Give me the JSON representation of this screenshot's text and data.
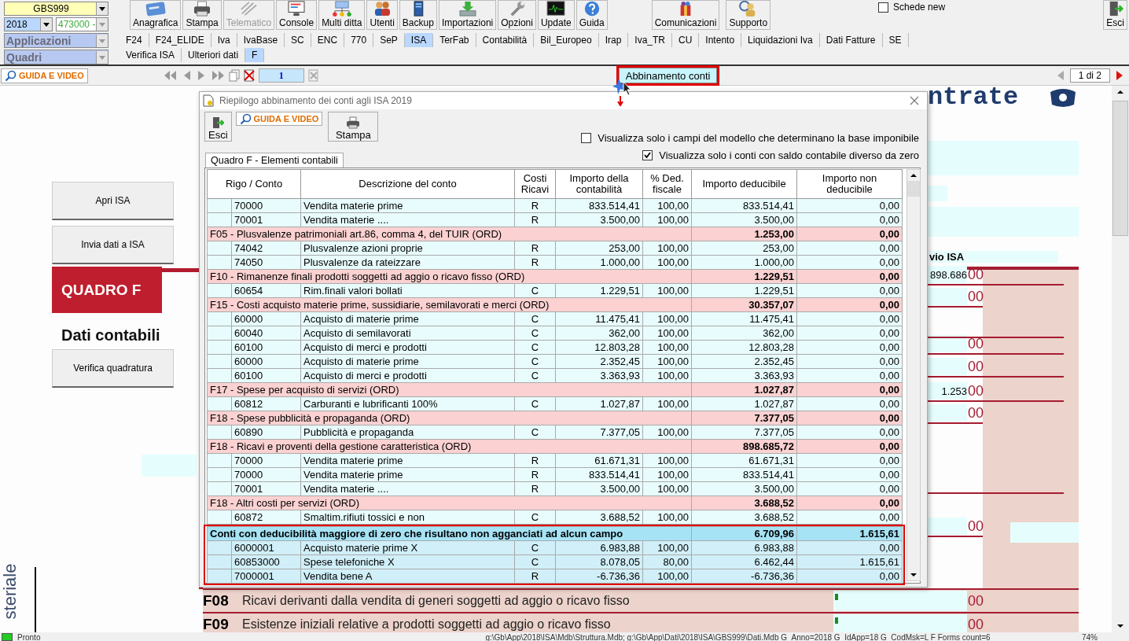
{
  "company_combo": {
    "value": "GBS999"
  },
  "year_combo": {
    "value": "2018"
  },
  "account_combo": {
    "value": "473000 -",
    "disabled": true
  },
  "applications_combo": {
    "value": "Applicazioni"
  },
  "panels_combo": {
    "value": "Quadri"
  },
  "toolbar": [
    {
      "label": "Anagrafica",
      "disabled": false
    },
    {
      "label": "Stampa",
      "disabled": false
    },
    {
      "label": "Telematico",
      "disabled": true
    },
    {
      "label": "Console",
      "disabled": false
    },
    {
      "label": "Multi ditta",
      "disabled": false
    },
    {
      "label": "Utenti",
      "disabled": false
    },
    {
      "label": "Backup",
      "disabled": false
    },
    {
      "label": "Importazioni",
      "disabled": false
    },
    {
      "label": "Opzioni",
      "disabled": false
    },
    {
      "label": "Update",
      "disabled": false
    },
    {
      "label": "Guida",
      "disabled": false
    }
  ],
  "toolbar_right": [
    {
      "label": "Comunicazioni"
    },
    {
      "label": "Supporto"
    }
  ],
  "schede_new": {
    "label": "Schede new",
    "checked": false
  },
  "exit_button": {
    "label": "Esci"
  },
  "app_tabs": [
    {
      "label": "F24",
      "selected": false
    },
    {
      "label": "F24_ELIDE",
      "selected": false
    },
    {
      "label": "Iva",
      "selected": false
    },
    {
      "label": "IvaBase",
      "selected": false
    },
    {
      "label": "SC",
      "selected": false
    },
    {
      "label": "ENC",
      "selected": false
    },
    {
      "label": "770",
      "selected": false
    },
    {
      "label": "SeP",
      "selected": false
    },
    {
      "label": "ISA",
      "selected": true
    },
    {
      "label": "TerFab",
      "selected": false
    },
    {
      "label": "Contabilità",
      "selected": false
    },
    {
      "label": "Bil_Europeo",
      "selected": false
    },
    {
      "label": "Irap",
      "selected": false
    },
    {
      "label": "Iva_TR",
      "selected": false
    },
    {
      "label": "CU",
      "selected": false
    },
    {
      "label": "Intento",
      "selected": false
    },
    {
      "label": "Liquidazioni Iva",
      "selected": false
    },
    {
      "label": "Dati Fatture",
      "selected": false
    },
    {
      "label": "SE",
      "selected": false
    }
  ],
  "sub_tabs": [
    {
      "label": "Verifica ISA",
      "selected": false
    },
    {
      "label": "Ulteriori dati",
      "selected": false
    },
    {
      "label": "F",
      "selected": true
    }
  ],
  "nav_bar": {
    "help_button": "GUIDA E VIDEO",
    "page": "1",
    "match_button": {
      "label": "Abbinamento conti",
      "highlighted": true
    },
    "page_counter": "1 di 2"
  },
  "document": {
    "logo_text": "ntrate",
    "buttons": [
      "Apri ISA",
      "Invia dati a ISA"
    ],
    "section_title": "QUADRO F",
    "subtitle": "Dati contabili",
    "verify_button": "Verifica quadratura",
    "column_heading": "vio ISA",
    "side_text": "steriale",
    "fields": [
      {
        "value": "898.686",
        "cents": "00"
      },
      {
        "cents": "00"
      },
      {
        "cents": "00"
      },
      {
        "cents": "00"
      },
      {
        "value": "1.253",
        "cents": "00"
      },
      {
        "cents": "00"
      },
      {
        "cents": "00"
      }
    ],
    "lines": [
      {
        "code": "F08",
        "text": "Ricavi derivanti dalla vendita di generi soggetti ad aggio o ricavo fisso",
        "cents": "00"
      },
      {
        "code": "F09",
        "text": "Esistenze iniziali relative a prodotti soggetti ad aggio o ricavo fisso",
        "cents": "00"
      }
    ]
  },
  "dialog": {
    "title": "Riepilogo abbinamento dei conti agli ISA 2019",
    "exit_button": "Esci",
    "help_button": "GUIDA E VIDEO",
    "print_button": "Stampa",
    "options": [
      {
        "label": "Visualizza solo i campi del modello che determinano la base imponibile",
        "checked": false
      },
      {
        "label": "Visualizza solo i conti con saldo contabile diverso da zero",
        "checked": true
      }
    ],
    "tab": "Quadro F - Elementi contabili",
    "columns": [
      "Rigo / Conto",
      "Descrizione del conto",
      "Costi Ricavi",
      "Importo della contabilità",
      "% Ded. fiscale",
      "Importo deducibile",
      "Importo non deducibile"
    ],
    "rows": [
      {
        "kind": "account",
        "code": "70000",
        "description": "Vendita materie prime",
        "type": "R",
        "amount": "833.514,41",
        "percent": "100,00",
        "deductible": "833.514,41",
        "non_deductible": "0,00"
      },
      {
        "kind": "account",
        "code": "70001",
        "description": "Vendita materie ....",
        "type": "R",
        "amount": "3.500,00",
        "percent": "100,00",
        "deductible": "3.500,00",
        "non_deductible": "0,00"
      },
      {
        "kind": "group",
        "title": "F05 - Plusvalenze patrimoniali art.86, comma 4, del TUIR (ORD)",
        "deductible": "1.253,00",
        "non_deductible": "0,00"
      },
      {
        "kind": "account",
        "code": "74042",
        "description": "Plusvalenze azioni proprie",
        "type": "R",
        "amount": "253,00",
        "percent": "100,00",
        "deductible": "253,00",
        "non_deductible": "0,00"
      },
      {
        "kind": "account",
        "code": "74050",
        "description": "Plusvalenze da rateizzare",
        "type": "R",
        "amount": "1.000,00",
        "percent": "100,00",
        "deductible": "1.000,00",
        "non_deductible": "0,00"
      },
      {
        "kind": "group",
        "title": "F10 - Rimanenze finali prodotti soggetti ad aggio o ricavo fisso (ORD)",
        "deductible": "1.229,51",
        "non_deductible": "0,00"
      },
      {
        "kind": "account",
        "code": "60654",
        "description": "Rim.finali valori bollati",
        "type": "C",
        "amount": "1.229,51",
        "percent": "100,00",
        "deductible": "1.229,51",
        "non_deductible": "0,00"
      },
      {
        "kind": "group",
        "title": "F15 - Costi acquisto materie prime, sussidiarie, semilavorati e merci (ORD)",
        "deductible": "30.357,07",
        "non_deductible": "0,00"
      },
      {
        "kind": "account",
        "code": "60000",
        "description": "Acquisto di materie prime",
        "type": "C",
        "amount": "11.475,41",
        "percent": "100,00",
        "deductible": "11.475,41",
        "non_deductible": "0,00"
      },
      {
        "kind": "account",
        "code": "60040",
        "description": "Acquisto di semilavorati",
        "type": "C",
        "amount": "362,00",
        "percent": "100,00",
        "deductible": "362,00",
        "non_deductible": "0,00"
      },
      {
        "kind": "account",
        "code": "60100",
        "description": "Acquisto di merci e prodotti",
        "type": "C",
        "amount": "12.803,28",
        "percent": "100,00",
        "deductible": "12.803,28",
        "non_deductible": "0,00"
      },
      {
        "kind": "account",
        "code": "60000",
        "description": "Acquisto di materie prime",
        "type": "C",
        "amount": "2.352,45",
        "percent": "100,00",
        "deductible": "2.352,45",
        "non_deductible": "0,00"
      },
      {
        "kind": "account",
        "code": "60100",
        "description": "Acquisto di merci e prodotti",
        "type": "C",
        "amount": "3.363,93",
        "percent": "100,00",
        "deductible": "3.363,93",
        "non_deductible": "0,00"
      },
      {
        "kind": "group",
        "title": "F17 - Spese per acquisto di servizi (ORD)",
        "deductible": "1.027,87",
        "non_deductible": "0,00"
      },
      {
        "kind": "account",
        "code": "60812",
        "description": "Carburanti e lubrificanti 100%",
        "type": "C",
        "amount": "1.027,87",
        "percent": "100,00",
        "deductible": "1.027,87",
        "non_deductible": "0,00"
      },
      {
        "kind": "group",
        "title": "F18 - Spese pubblicità e propaganda (ORD)",
        "deductible": "7.377,05",
        "non_deductible": "0,00"
      },
      {
        "kind": "account",
        "code": "60890",
        "description": "Pubblicità e propaganda",
        "type": "C",
        "amount": "7.377,05",
        "percent": "100,00",
        "deductible": "7.377,05",
        "non_deductible": "0,00"
      },
      {
        "kind": "group",
        "title": "F18 - Ricavi e proventi della gestione caratteristica (ORD)",
        "deductible": "898.685,72",
        "non_deductible": "0,00"
      },
      {
        "kind": "account",
        "code": "70000",
        "description": "Vendita materie prime",
        "type": "R",
        "amount": "61.671,31",
        "percent": "100,00",
        "deductible": "61.671,31",
        "non_deductible": "0,00"
      },
      {
        "kind": "account",
        "code": "70000",
        "description": "Vendita materie prime",
        "type": "R",
        "amount": "833.514,41",
        "percent": "100,00",
        "deductible": "833.514,41",
        "non_deductible": "0,00"
      },
      {
        "kind": "account",
        "code": "70001",
        "description": "Vendita materie ....",
        "type": "R",
        "amount": "3.500,00",
        "percent": "100,00",
        "deductible": "3.500,00",
        "non_deductible": "0,00"
      },
      {
        "kind": "group",
        "title": "F18 - Altri costi per servizi (ORD)",
        "deductible": "3.688,52",
        "non_deductible": "0,00"
      },
      {
        "kind": "account",
        "code": "60872",
        "description": "Smaltim.rifiuti tossici e non",
        "type": "C",
        "amount": "3.688,52",
        "percent": "100,00",
        "deductible": "3.688,52",
        "non_deductible": "0,00"
      }
    ],
    "unmatched": {
      "highlighted": true,
      "title": "Conti con deducibilità maggiore di zero che risultano non agganciati ad alcun campo",
      "deductible": "6.709,96",
      "non_deductible": "1.615,61",
      "rows": [
        {
          "code": "6000001",
          "description": "Acquisto materie prime X",
          "type": "C",
          "amount": "6.983,88",
          "percent": "100,00",
          "deductible": "6.983,88",
          "non_deductible": "0,00"
        },
        {
          "code": "60853000",
          "description": "Spese telefoniche X",
          "type": "C",
          "amount": "8.078,05",
          "percent": "80,00",
          "deductible": "6.462,44",
          "non_deductible": "1.615,61"
        },
        {
          "code": "7000001",
          "description": "Vendita bene A",
          "type": "R",
          "amount": "-6.736,36",
          "percent": "100,00",
          "deductible": "-6.736,36",
          "non_deductible": "0,00"
        }
      ]
    }
  },
  "status_bar": {
    "status": "Pronto",
    "path": "g:\\Gb\\App\\2018\\ISA\\Mdb\\Struttura.Mdb; g:\\Gb\\App\\Dati\\2018\\ISA\\GBS999\\Dati.Mdb G_Anno=2018 G_IdApp=18 G_CodMsk=L F Forms count=6",
    "zoom": "74%"
  }
}
